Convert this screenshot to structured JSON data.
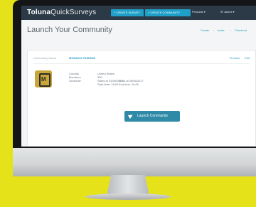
{
  "app": {
    "logo_bold": "Toluna",
    "logo_light": "QuickSurveys"
  },
  "header": {
    "create_survey_label": "+ CREATE SURVEY",
    "create_community_label": "+ CREATE COMMUNITY",
    "nav_products_label": "Products ▾",
    "nav_user_label": "☰ James ▾"
  },
  "page": {
    "title": "Launch Your Community",
    "steps": [
      "Create",
      "Invite",
      "Checkout"
    ],
    "separator": "›"
  },
  "community": {
    "label": "Community Name",
    "name": "MONACO FASHION",
    "actions": {
      "preview": "Preview",
      "edit": "Edit"
    },
    "badge_letter": "M",
    "details": {
      "country_label": "Country",
      "members_label": "Members",
      "schedule_label": "Schedule",
      "country": "United States",
      "members": "350",
      "starts": "Starts at 03/06/2017",
      "start_time": "Start time: 16:00",
      "ends": "Ends at 08/06/2017",
      "end_time": "End time: 16:00"
    }
  },
  "launch": {
    "label": "Launch Community"
  },
  "colors": {
    "accent": "#1fa0c8",
    "topbar": "#2b3a46",
    "launch_button": "#2f8aa8",
    "background": "#e6e21a"
  },
  "icons": {
    "launch": "paper-plane-icon",
    "badge": "community-badge-icon"
  }
}
